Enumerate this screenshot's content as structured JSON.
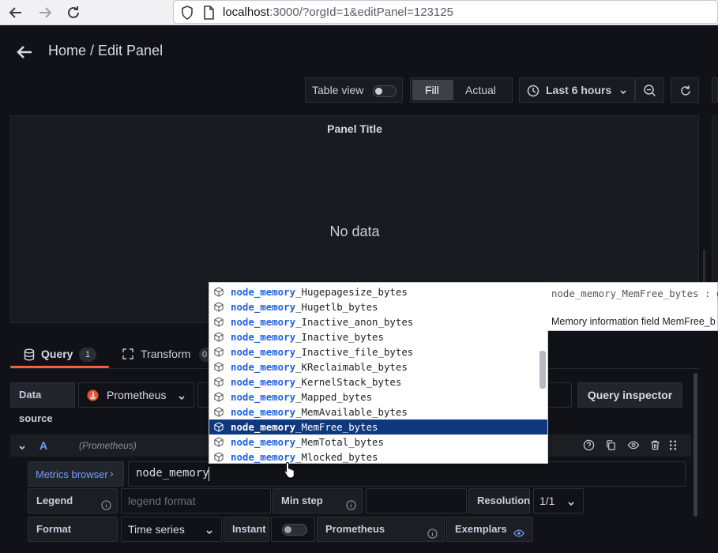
{
  "browser": {
    "url_host": "localhost",
    "url_rest": ":3000/?orgId=1&editPanel=123125"
  },
  "header": {
    "title": "Home / Edit Panel"
  },
  "toolbar": {
    "table_view_label": "Table view",
    "fill_label": "Fill",
    "actual_label": "Actual",
    "time_range_label": "Last 6 hours"
  },
  "panel": {
    "title": "Panel Title",
    "no_data": "No data"
  },
  "tabs": {
    "query_label": "Query",
    "query_count": "1",
    "transform_label": "Transform",
    "transform_count": "0"
  },
  "query": {
    "datasource_label": "Data source",
    "datasource_value": "Prometheus",
    "query_inspector": "Query inspector",
    "row_letter": "A",
    "row_datasource": "(Prometheus)",
    "metrics_browser": "Metrics browser",
    "query_text": "node_memory",
    "legend_label": "Legend",
    "legend_placeholder": "legend format",
    "min_step_label": "Min step",
    "resolution_label": "Resolution",
    "resolution_value": "1/1",
    "format_label": "Format",
    "format_value": "Time series",
    "instant_label": "Instant",
    "prometheus_label": "Prometheus",
    "exemplars_label": "Exemplars"
  },
  "autocomplete": {
    "prefix": "node_memory",
    "items": [
      "_Hugepagesize_bytes",
      "_Hugetlb_bytes",
      "_Inactive_anon_bytes",
      "_Inactive_bytes",
      "_Inactive_file_bytes",
      "_KReclaimable_bytes",
      "_KernelStack_bytes",
      "_Mapped_bytes",
      "_MemAvailable_bytes",
      "_MemFree_bytes",
      "_MemTotal_bytes",
      "_Mlocked_bytes"
    ],
    "selected_index": 9,
    "detail_signature": "node_memory_MemFree_bytes : g",
    "detail_doc": "Memory information field MemFree_b"
  },
  "colors": {
    "accent_orange": "#f55f3e",
    "selection_blue": "#0f3880",
    "prefix_blue": "#1f62e0",
    "link_blue": "#6e9fff"
  }
}
